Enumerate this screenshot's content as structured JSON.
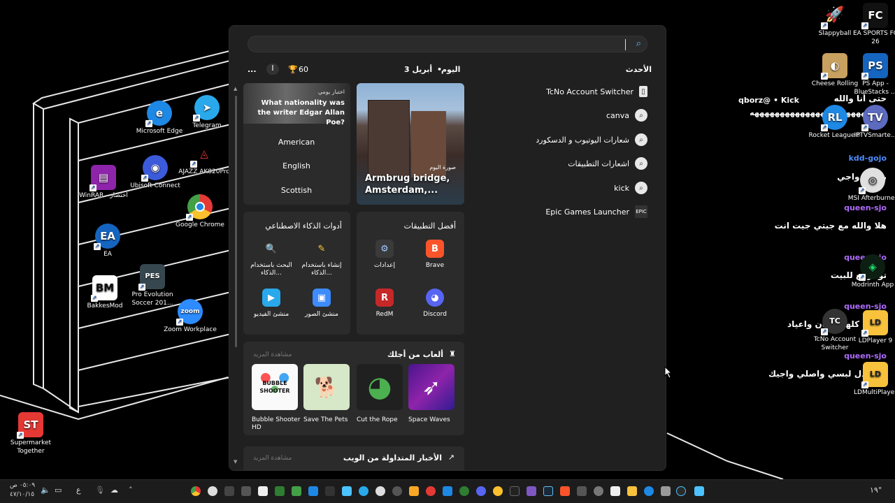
{
  "desktop": {
    "left_icons": [
      {
        "label": "Microsoft Edge",
        "glyph": "e",
        "color": "#1e88e5"
      },
      {
        "label": "Telegram",
        "glyph": "➤",
        "color": "#29a9eb"
      },
      {
        "label": "WinRAR - اختصار",
        "glyph": "▤",
        "color": "#8e24aa"
      },
      {
        "label": "Ubisoft Connect",
        "glyph": "◉",
        "color": "#3b5bdb"
      },
      {
        "label": "AJAZZ AK820Pro",
        "glyph": "◬",
        "color": "#b71c1c"
      },
      {
        "label": "Google Chrome",
        "glyph": "◎",
        "color": "#e53935"
      },
      {
        "label": "EA",
        "glyph": "EA",
        "color": "#1565c0"
      },
      {
        "label": "BakkesMod",
        "glyph": "BM",
        "color": "#222222"
      },
      {
        "label": "Pro Evolution Soccer 201...",
        "glyph": "PES",
        "color": "#37474f"
      },
      {
        "label": "Zoom Workplace",
        "glyph": "zoom",
        "color": "#2d8cff"
      },
      {
        "label": "Supermarket Together",
        "glyph": "ST",
        "color": "#e53935"
      }
    ],
    "right_icons": [
      {
        "label": "Slappyball",
        "glyph": "🚀",
        "color": "#cccccc"
      },
      {
        "label": "EA SPORTS FC 26",
        "glyph": "FC",
        "color": "#111111"
      },
      {
        "label": "Cheese Rolling",
        "glyph": "◐",
        "color": "#c8a060"
      },
      {
        "label": "PS App - BlueStacks ...",
        "glyph": "PS",
        "color": "#1565c0"
      },
      {
        "label": "Rocket League®",
        "glyph": "RL",
        "color": "#1e88e5"
      },
      {
        "label": "IPTVSmarte...",
        "glyph": "TV",
        "color": "#5c6bc0"
      },
      {
        "label": "MSI Afterburner",
        "glyph": "◎",
        "color": "#e0e0e0"
      },
      {
        "label": "Modrinth App",
        "glyph": "◈",
        "color": "#1bd96a"
      },
      {
        "label": "TcNo Account Switcher",
        "glyph": "TC",
        "color": "#333333"
      },
      {
        "label": "LDPlayer 9",
        "glyph": "LD",
        "color": "#f9c23c"
      },
      {
        "label": "LDMultiPlayer",
        "glyph": "LD",
        "color": "#f9c23c"
      }
    ]
  },
  "chat": {
    "lines": [
      {
        "name": "qborz@ • Kick",
        "name_color": "#ffffff",
        "msg": "حتى أنا والله"
      },
      {
        "name": "",
        "name_color": "#ffffff",
        "msg": "ههههههههههههههههههههههههههه"
      },
      {
        "name": "kdd-gojo",
        "name_color": "#4f8cff",
        "msg": "بصباح واجي"
      },
      {
        "name": "queen-sjo",
        "name_color": "#b06bff",
        "msg": "هلا والله مع جيتي جيت انت"
      },
      {
        "name": "queen-sjo",
        "name_color": "#b06bff",
        "msg": "تو ارجع للبيت"
      },
      {
        "name": "queen-sjo",
        "name_color": "#b06bff",
        "msg": "حياتي كلها عشان واعياد"
      },
      {
        "name": "queen-sjo",
        "name_color": "#b06bff",
        "msg": "فبر بدل لبسي واصلي واجيك"
      }
    ]
  },
  "start_menu": {
    "search_placeholder": "",
    "today_label": "اليوم",
    "date_label": "3 أبريل",
    "points": "60",
    "more_label": "...",
    "recent_header": "الأحدث",
    "recent": [
      {
        "label": "TcNo Account Switcher",
        "icon": "file-icon"
      },
      {
        "label": "canva",
        "icon": "search-icon"
      },
      {
        "label": "شعارات اليوتيوب و الدسكورد",
        "icon": "search-icon"
      },
      {
        "label": "اشعارات التطبيقات",
        "icon": "search-icon"
      },
      {
        "label": "kick",
        "icon": "search-icon"
      },
      {
        "label": "Epic Games Launcher",
        "icon": "epic-icon"
      }
    ],
    "quiz": {
      "tag": "اختبار يومي",
      "question": "What nationality was the writer Edgar Allan Poe?",
      "options": [
        "American",
        "English",
        "Scottish"
      ]
    },
    "photo": {
      "tag": "صورة اليوم",
      "title": "Armbrug bridge, Amsterdam,..."
    },
    "ai_tools": {
      "title": "أدوات الذكاء الاصطناعي",
      "items": [
        {
          "label": "البحث باستخدام الذكاء...",
          "glyph": "🔍",
          "color": "#2b2b2b"
        },
        {
          "label": "إنشاء باستخدام الذكاء...",
          "glyph": "✎",
          "color": "#2b2b2b"
        },
        {
          "label": "منشئ الفيديو",
          "glyph": "▶",
          "color": "#2b2b2b"
        },
        {
          "label": "منشئ الصور",
          "glyph": "▣",
          "color": "#2b2b2b"
        }
      ]
    },
    "top_apps": {
      "title": "أفضل التطبيقات",
      "items": [
        {
          "label": "إعدادات",
          "glyph": "⚙",
          "color": "#3a3a3a"
        },
        {
          "label": "Brave",
          "glyph": "B",
          "color": "#fb542b"
        },
        {
          "label": "RedM",
          "glyph": "R",
          "color": "#c62828"
        },
        {
          "label": "Discord",
          "glyph": "◕",
          "color": "#5865f2"
        }
      ]
    },
    "games": {
      "title": "ألعاب من أجلك",
      "see_more": "مشاهدة المزيد",
      "items": [
        {
          "label": "Bubble Shooter HD",
          "glyph": "BUBBLE SHOOTER",
          "color": "#ffffff"
        },
        {
          "label": "Save The Pets",
          "glyph": "🐕",
          "color": "#d6e8c8"
        },
        {
          "label": "Cut the Rope",
          "glyph": "◕",
          "color": "#2e7d32"
        },
        {
          "label": "Space Waves",
          "glyph": "➶",
          "color": "#6a1b9a"
        }
      ]
    },
    "trending": {
      "title": "الأخبار المتداولة من الويب",
      "see_more": "مشاهدة المزيد"
    }
  },
  "taskbar": {
    "time": "٠٥:٠٩ ص",
    "date": "٤٧/١٠/١٥",
    "lang": "ع",
    "temp": "١٩°"
  }
}
